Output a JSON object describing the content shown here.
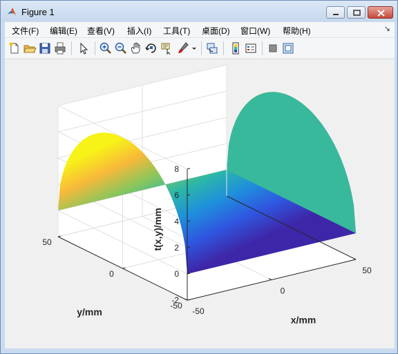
{
  "window": {
    "title": "Figure 1"
  },
  "menu": [
    {
      "label": "文件(F)"
    },
    {
      "label": "编辑(E)"
    },
    {
      "label": "查看(V)"
    },
    {
      "label": "插入(I)"
    },
    {
      "label": "工具(T)"
    },
    {
      "label": "桌面(D)"
    },
    {
      "label": "窗口(W)"
    },
    {
      "label": "帮助(H)"
    }
  ],
  "toolbar": {
    "icons": [
      "new-figure-icon",
      "open-file-icon",
      "save-icon",
      "print-icon",
      "pointer-icon",
      "zoom-in-icon",
      "zoom-out-icon",
      "pan-icon",
      "rotate-3d-icon",
      "data-cursor-icon",
      "brush-icon",
      "link-plot-icon",
      "colorbar-icon",
      "legend-icon",
      "hide-plot-tools-icon",
      "show-plot-tools-icon"
    ]
  },
  "chart_data": {
    "type": "surface",
    "title": "",
    "xlabel": "x/mm",
    "ylabel": "y/mm",
    "zlabel": "t(x,y)/mm",
    "xlim": [
      -50,
      50
    ],
    "ylim": [
      -50,
      50
    ],
    "zlim": [
      -2,
      8
    ],
    "xticks": [
      "-50",
      "0",
      "50"
    ],
    "yticks": [
      "-50",
      "0",
      "50"
    ],
    "zticks": [
      "-2",
      "0",
      "2",
      "4",
      "6",
      "8"
    ],
    "shape": "half-cylinder ridge along x, t(y) rises from 0 at y=±50 to a peak of about 8 at y=0",
    "peak": 8,
    "colormap": "parula",
    "grid": true
  }
}
